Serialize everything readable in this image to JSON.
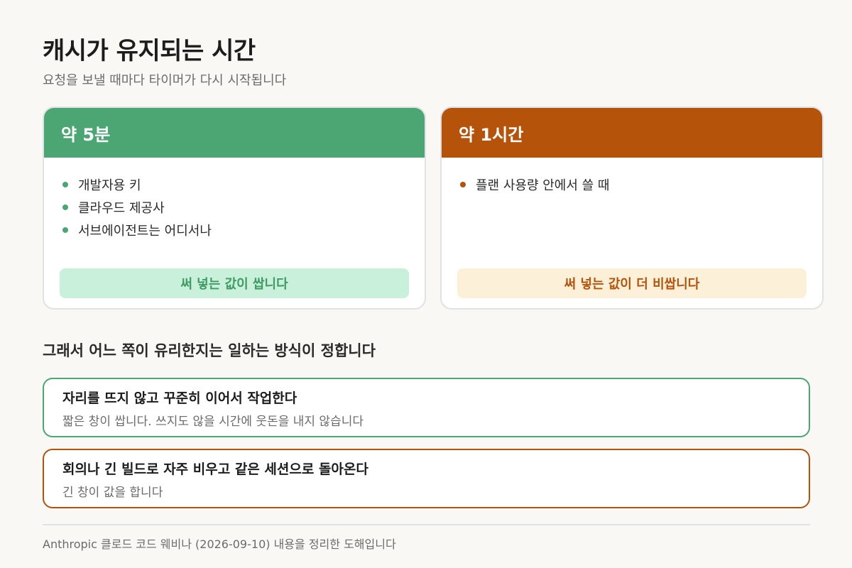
{
  "header": {
    "title": "캐시가 유지되는 시간",
    "subtitle": "요청을 보낼 때마다 타이머가 다시 시작됩니다"
  },
  "cards": [
    {
      "heading": "약 5분",
      "items": [
        "개발자용 키",
        "클라우드 제공사",
        "서브에이전트는 어디서나"
      ],
      "badge": "써 넣는 값이 쌉니다",
      "accent": "#4ca673"
    },
    {
      "heading": "약 1시간",
      "items": [
        "플랜 사용량 안에서 쓸 때"
      ],
      "badge": "써 넣는 값이 더 비쌉니다",
      "accent": "#b5530b"
    }
  ],
  "section": {
    "heading": "그래서 어느 쪽이 유리한지는 일하는 방식이 정합니다"
  },
  "options": [
    {
      "title": "자리를 뜨지 않고 꾸준히 이어서 작업한다",
      "description": "짧은 창이 쌉니다. 쓰지도 않을 시간에 웃돈을 내지 않습니다",
      "accent": "#4ca673"
    },
    {
      "title": "회의나 긴 빌드로 자주 비우고 같은 세션으로 돌아온다",
      "description": "긴 창이 값을 합니다",
      "accent": "#b5530b"
    }
  ],
  "footer": {
    "text": "Anthropic 클로드 코드 웨비나 (2026-09-10) 내용을 정리한 도해입니다"
  }
}
